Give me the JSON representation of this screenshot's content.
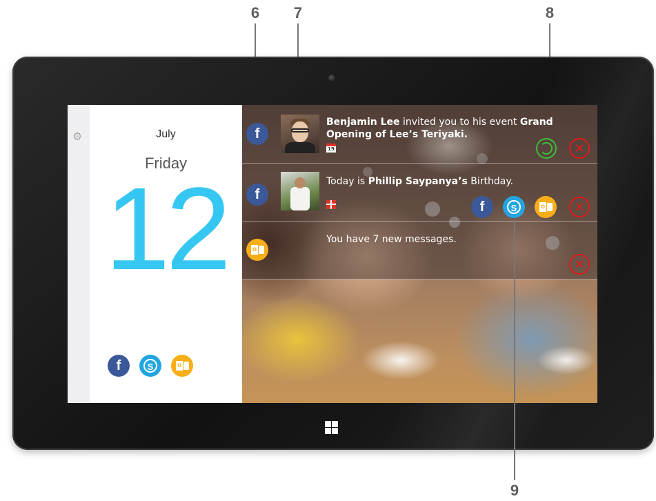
{
  "callouts": {
    "six": "6",
    "seven": "7",
    "eight": "8",
    "nine": "9"
  },
  "date_panel": {
    "month": "July",
    "weekday": "Friday",
    "day": "12",
    "day_color": "#35c7f2",
    "settings_icon": "gear-icon",
    "services": [
      "facebook-icon",
      "skype-icon",
      "outlook-icon"
    ]
  },
  "notifications": [
    {
      "service": "facebook",
      "icon": "facebook-icon",
      "sender": "Benjamin Lee",
      "text_middle": " invited you to his event ",
      "event": "Grand Opening of Lee’s Teriyaki.",
      "calendar_day": "19",
      "actions": [
        "accept",
        "dismiss"
      ]
    },
    {
      "service": "facebook",
      "icon": "facebook-icon",
      "text_start": "Today is ",
      "person": "Phillip Saypanya’s",
      "text_end": " Birthday.",
      "small_icon": "gift-icon",
      "share_services": [
        "facebook-icon",
        "skype-icon",
        "outlook-icon"
      ],
      "actions": [
        "dismiss"
      ]
    },
    {
      "service": "outlook",
      "icon": "outlook-icon",
      "text": "You have 7 new messages.",
      "actions": [
        "dismiss"
      ]
    }
  ],
  "glyphs": {
    "facebook": "f",
    "skype": "S",
    "outlook": "o",
    "dismiss": "✕"
  },
  "colors": {
    "facebook": "#3b5998",
    "skype": "#22a5e0",
    "outlook": "#f7ae17",
    "dismiss": "#e11a1a",
    "accept": "#3cbd3c"
  }
}
